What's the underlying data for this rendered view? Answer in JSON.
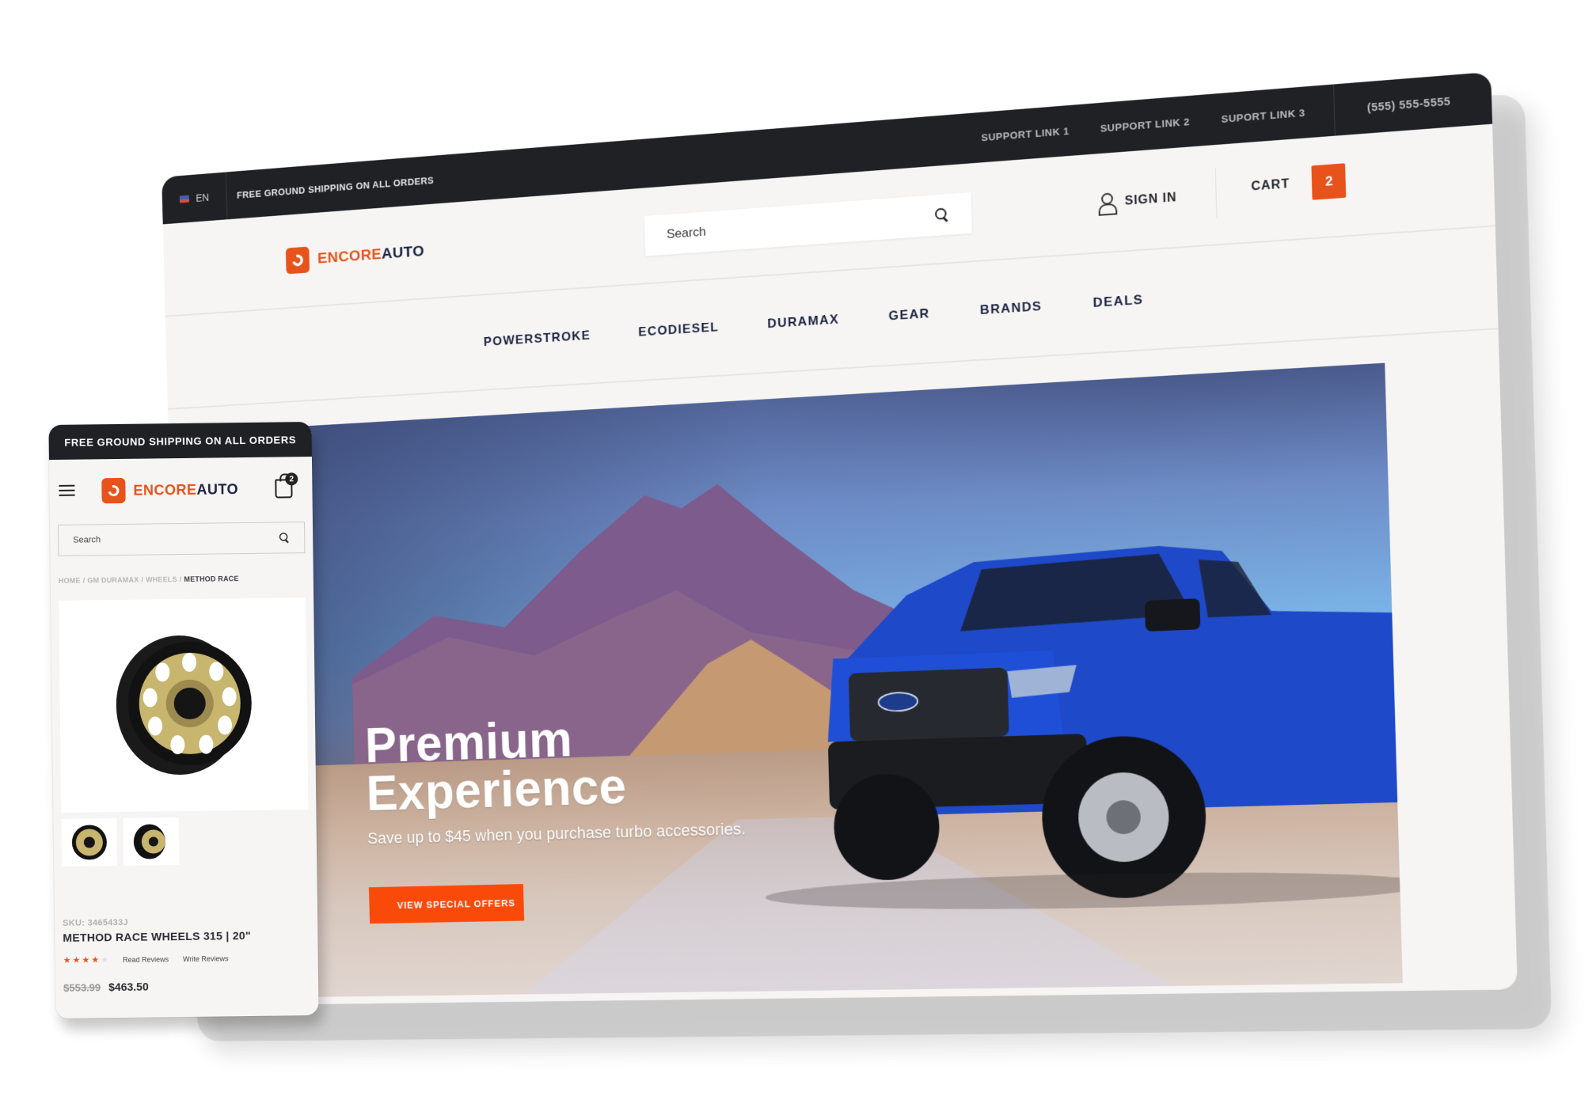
{
  "colors": {
    "brand_orange": "#e8521b",
    "brand_navy": "#1c2340",
    "topbar_bg": "#202125",
    "cta_orange": "#fa4a0a",
    "page_bg": "#f6f5f4"
  },
  "desktop": {
    "topbar": {
      "flag_icon": "us-flag-icon",
      "language": "EN",
      "promo": "FREE GROUND SHIPPING ON ALL ORDERS",
      "support_links": [
        "SUPPORT LINK 1",
        "SUPPORT LINK 2",
        "SUPORT LINK 3"
      ],
      "phone": "(555) 555-5555"
    },
    "header": {
      "logo": {
        "part1": "ENCORE",
        "part2": "AUTO"
      },
      "search": {
        "placeholder": "Search",
        "icon": "search-icon"
      },
      "signin": {
        "label": "SIGN IN",
        "icon": "user-icon"
      },
      "cart": {
        "label": "CART",
        "count": "2"
      }
    },
    "nav": [
      "POWERSTROKE",
      "ECODIESEL",
      "DURAMAX",
      "GEAR",
      "BRANDS",
      "DEALS"
    ],
    "hero": {
      "title_line1": "Premium",
      "title_line2": "Experience",
      "subtitle": "Save up to $45 when you purchase turbo accessories.",
      "cta": "VIEW SPECIAL OFFERS"
    }
  },
  "mobile": {
    "topbar": "FREE GROUND SHIPPING ON ALL ORDERS",
    "logo": {
      "part1": "ENCORE",
      "part2": "AUTO"
    },
    "cart_count": "2",
    "search_placeholder": "Search",
    "breadcrumb": [
      "HOME",
      "GM DURAMAX",
      "WHEELS",
      "METHOD RACE"
    ],
    "product": {
      "sku": "SKU: 3465433J",
      "title": "METHOD RACE WHEELS 315 | 20\"",
      "rating": 4,
      "rating_max": 5,
      "read_reviews": "Read Reviews",
      "write_reviews": "Write Reviews",
      "old_price": "$553.99",
      "price": "$463.50",
      "thumbnails": 2
    }
  }
}
